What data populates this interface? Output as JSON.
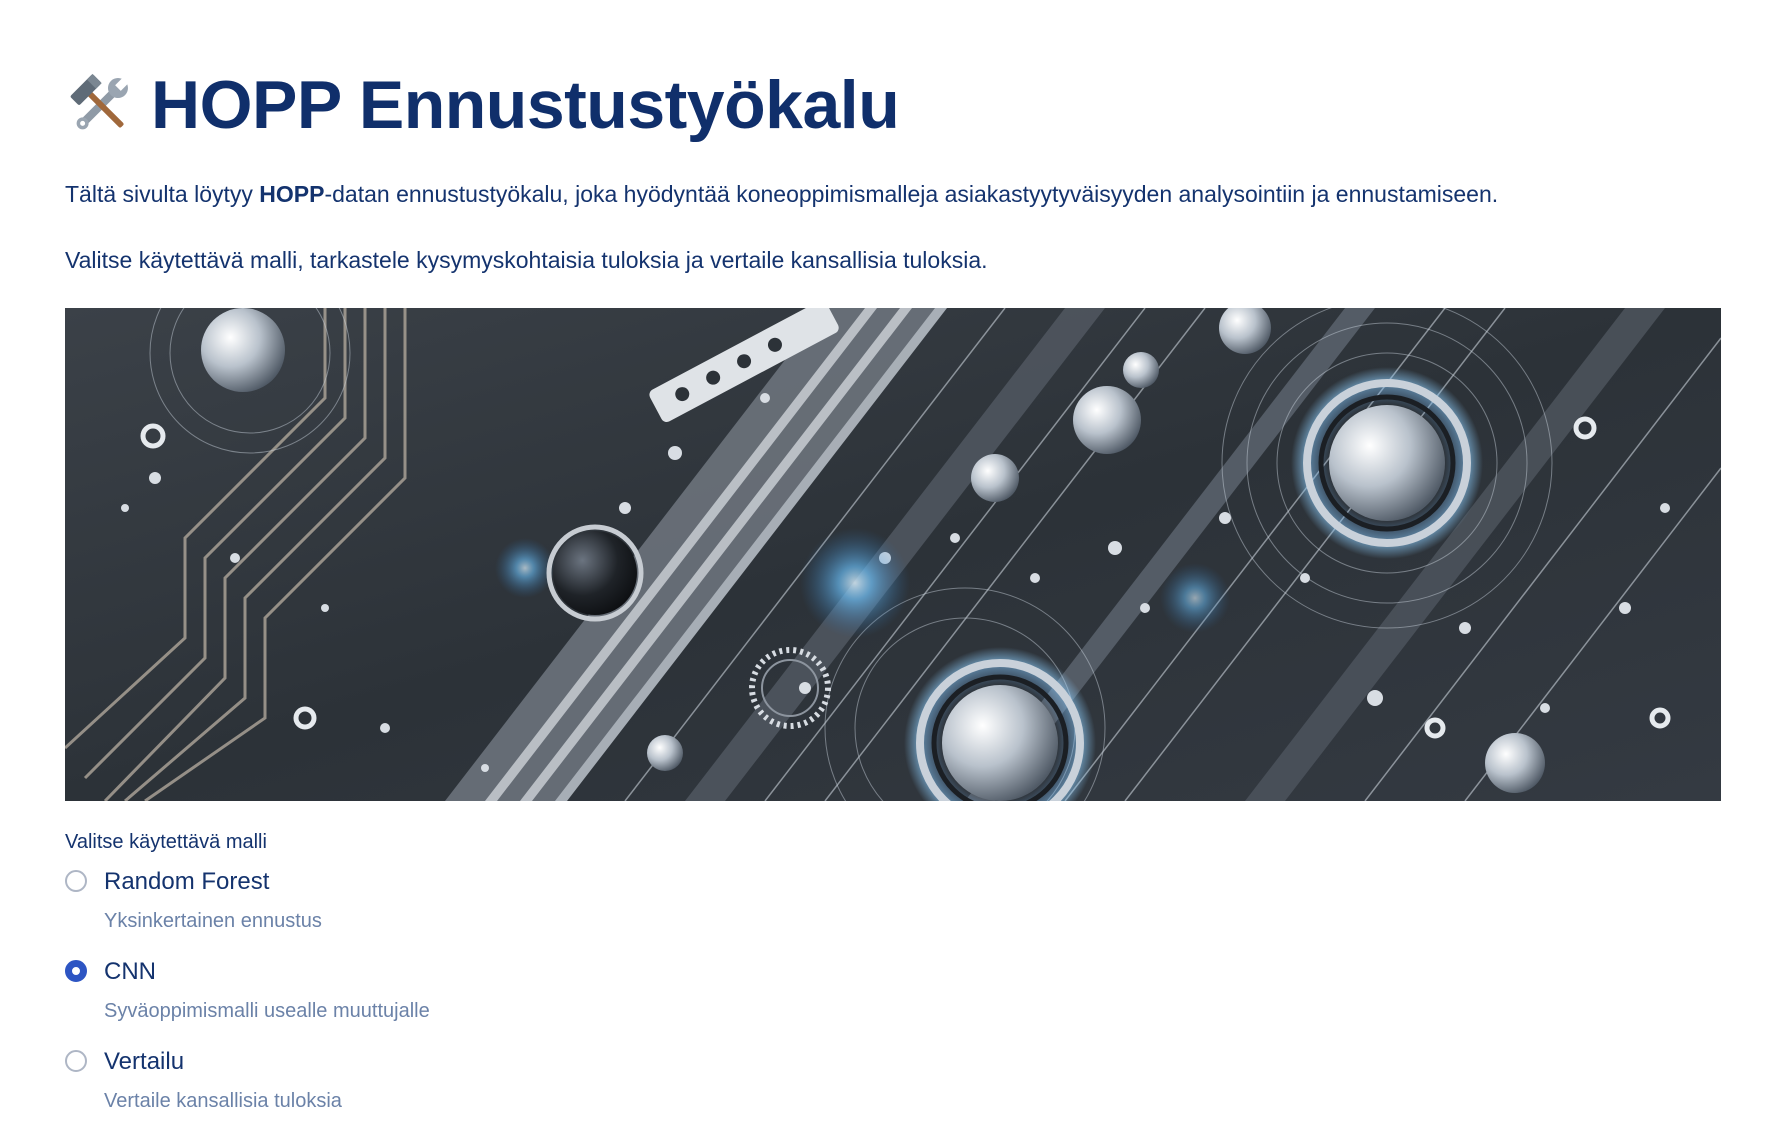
{
  "header": {
    "title": "HOPP Ennustustyökalu",
    "icon": "hammer-and-wrench-icon"
  },
  "intro": {
    "before": "Tältä sivulta löytyy ",
    "bold": "HOPP",
    "after": "-datan ennustustyökalu, joka hyödyntää koneoppimismalleja asiakastyytyväisyyden analysointiin ja ennustamiseen.",
    "second": "Valitse käytettävä malli, tarkastele kysymyskohtaisia tuloksia ja vertaile kansallisia tuloksia."
  },
  "banner": {
    "icon": "circuit-board-banner-image"
  },
  "model_select": {
    "label": "Valitse käytettävä malli",
    "options": [
      {
        "label": "Random Forest",
        "caption": "Yksinkertainen ennustus",
        "selected": false
      },
      {
        "label": "CNN",
        "caption": "Syväoppimismalli usealle muuttujalle",
        "selected": true
      },
      {
        "label": "Vertailu",
        "caption": "Vertaile kansallisia tuloksia",
        "selected": false
      }
    ]
  },
  "colors": {
    "text": "#14336e",
    "title": "#102f6b",
    "caption": "#6b82a8",
    "accent": "#2d55c3"
  }
}
